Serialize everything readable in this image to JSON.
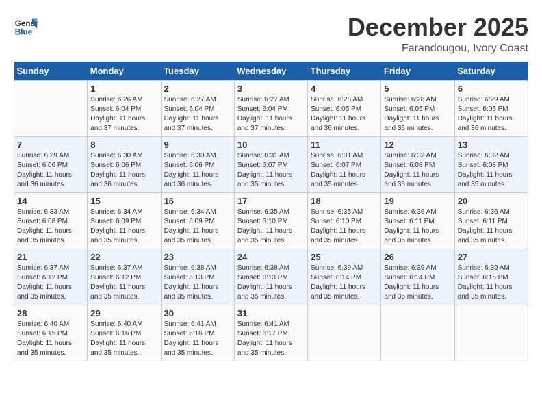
{
  "logo": {
    "text_general": "General",
    "text_blue": "Blue"
  },
  "title": {
    "month_year": "December 2025",
    "location": "Farandougou, Ivory Coast"
  },
  "days_of_week": [
    "Sunday",
    "Monday",
    "Tuesday",
    "Wednesday",
    "Thursday",
    "Friday",
    "Saturday"
  ],
  "weeks": [
    [
      {
        "day": "",
        "sunrise": "",
        "sunset": "",
        "daylight": ""
      },
      {
        "day": "1",
        "sunrise": "Sunrise: 6:26 AM",
        "sunset": "Sunset: 6:04 PM",
        "daylight": "Daylight: 11 hours and 37 minutes."
      },
      {
        "day": "2",
        "sunrise": "Sunrise: 6:27 AM",
        "sunset": "Sunset: 6:04 PM",
        "daylight": "Daylight: 11 hours and 37 minutes."
      },
      {
        "day": "3",
        "sunrise": "Sunrise: 6:27 AM",
        "sunset": "Sunset: 6:04 PM",
        "daylight": "Daylight: 11 hours and 37 minutes."
      },
      {
        "day": "4",
        "sunrise": "Sunrise: 6:28 AM",
        "sunset": "Sunset: 6:05 PM",
        "daylight": "Daylight: 11 hours and 36 minutes."
      },
      {
        "day": "5",
        "sunrise": "Sunrise: 6:28 AM",
        "sunset": "Sunset: 6:05 PM",
        "daylight": "Daylight: 11 hours and 36 minutes."
      },
      {
        "day": "6",
        "sunrise": "Sunrise: 6:29 AM",
        "sunset": "Sunset: 6:05 PM",
        "daylight": "Daylight: 11 hours and 36 minutes."
      }
    ],
    [
      {
        "day": "7",
        "sunrise": "Sunrise: 6:29 AM",
        "sunset": "Sunset: 6:06 PM",
        "daylight": "Daylight: 11 hours and 36 minutes."
      },
      {
        "day": "8",
        "sunrise": "Sunrise: 6:30 AM",
        "sunset": "Sunset: 6:06 PM",
        "daylight": "Daylight: 11 hours and 36 minutes."
      },
      {
        "day": "9",
        "sunrise": "Sunrise: 6:30 AM",
        "sunset": "Sunset: 6:06 PM",
        "daylight": "Daylight: 11 hours and 36 minutes."
      },
      {
        "day": "10",
        "sunrise": "Sunrise: 6:31 AM",
        "sunset": "Sunset: 6:07 PM",
        "daylight": "Daylight: 11 hours and 35 minutes."
      },
      {
        "day": "11",
        "sunrise": "Sunrise: 6:31 AM",
        "sunset": "Sunset: 6:07 PM",
        "daylight": "Daylight: 11 hours and 35 minutes."
      },
      {
        "day": "12",
        "sunrise": "Sunrise: 6:32 AM",
        "sunset": "Sunset: 6:08 PM",
        "daylight": "Daylight: 11 hours and 35 minutes."
      },
      {
        "day": "13",
        "sunrise": "Sunrise: 6:32 AM",
        "sunset": "Sunset: 6:08 PM",
        "daylight": "Daylight: 11 hours and 35 minutes."
      }
    ],
    [
      {
        "day": "14",
        "sunrise": "Sunrise: 6:33 AM",
        "sunset": "Sunset: 6:08 PM",
        "daylight": "Daylight: 11 hours and 35 minutes."
      },
      {
        "day": "15",
        "sunrise": "Sunrise: 6:34 AM",
        "sunset": "Sunset: 6:09 PM",
        "daylight": "Daylight: 11 hours and 35 minutes."
      },
      {
        "day": "16",
        "sunrise": "Sunrise: 6:34 AM",
        "sunset": "Sunset: 6:09 PM",
        "daylight": "Daylight: 11 hours and 35 minutes."
      },
      {
        "day": "17",
        "sunrise": "Sunrise: 6:35 AM",
        "sunset": "Sunset: 6:10 PM",
        "daylight": "Daylight: 11 hours and 35 minutes."
      },
      {
        "day": "18",
        "sunrise": "Sunrise: 6:35 AM",
        "sunset": "Sunset: 6:10 PM",
        "daylight": "Daylight: 11 hours and 35 minutes."
      },
      {
        "day": "19",
        "sunrise": "Sunrise: 6:36 AM",
        "sunset": "Sunset: 6:11 PM",
        "daylight": "Daylight: 11 hours and 35 minutes."
      },
      {
        "day": "20",
        "sunrise": "Sunrise: 6:36 AM",
        "sunset": "Sunset: 6:11 PM",
        "daylight": "Daylight: 11 hours and 35 minutes."
      }
    ],
    [
      {
        "day": "21",
        "sunrise": "Sunrise: 6:37 AM",
        "sunset": "Sunset: 6:12 PM",
        "daylight": "Daylight: 11 hours and 35 minutes."
      },
      {
        "day": "22",
        "sunrise": "Sunrise: 6:37 AM",
        "sunset": "Sunset: 6:12 PM",
        "daylight": "Daylight: 11 hours and 35 minutes."
      },
      {
        "day": "23",
        "sunrise": "Sunrise: 6:38 AM",
        "sunset": "Sunset: 6:13 PM",
        "daylight": "Daylight: 11 hours and 35 minutes."
      },
      {
        "day": "24",
        "sunrise": "Sunrise: 6:38 AM",
        "sunset": "Sunset: 6:13 PM",
        "daylight": "Daylight: 11 hours and 35 minutes."
      },
      {
        "day": "25",
        "sunrise": "Sunrise: 6:39 AM",
        "sunset": "Sunset: 6:14 PM",
        "daylight": "Daylight: 11 hours and 35 minutes."
      },
      {
        "day": "26",
        "sunrise": "Sunrise: 6:39 AM",
        "sunset": "Sunset: 6:14 PM",
        "daylight": "Daylight: 11 hours and 35 minutes."
      },
      {
        "day": "27",
        "sunrise": "Sunrise: 6:39 AM",
        "sunset": "Sunset: 6:15 PM",
        "daylight": "Daylight: 11 hours and 35 minutes."
      }
    ],
    [
      {
        "day": "28",
        "sunrise": "Sunrise: 6:40 AM",
        "sunset": "Sunset: 6:15 PM",
        "daylight": "Daylight: 11 hours and 35 minutes."
      },
      {
        "day": "29",
        "sunrise": "Sunrise: 6:40 AM",
        "sunset": "Sunset: 6:16 PM",
        "daylight": "Daylight: 11 hours and 35 minutes."
      },
      {
        "day": "30",
        "sunrise": "Sunrise: 6:41 AM",
        "sunset": "Sunset: 6:16 PM",
        "daylight": "Daylight: 11 hours and 35 minutes."
      },
      {
        "day": "31",
        "sunrise": "Sunrise: 6:41 AM",
        "sunset": "Sunset: 6:17 PM",
        "daylight": "Daylight: 11 hours and 35 minutes."
      },
      {
        "day": "",
        "sunrise": "",
        "sunset": "",
        "daylight": ""
      },
      {
        "day": "",
        "sunrise": "",
        "sunset": "",
        "daylight": ""
      },
      {
        "day": "",
        "sunrise": "",
        "sunset": "",
        "daylight": ""
      }
    ]
  ]
}
